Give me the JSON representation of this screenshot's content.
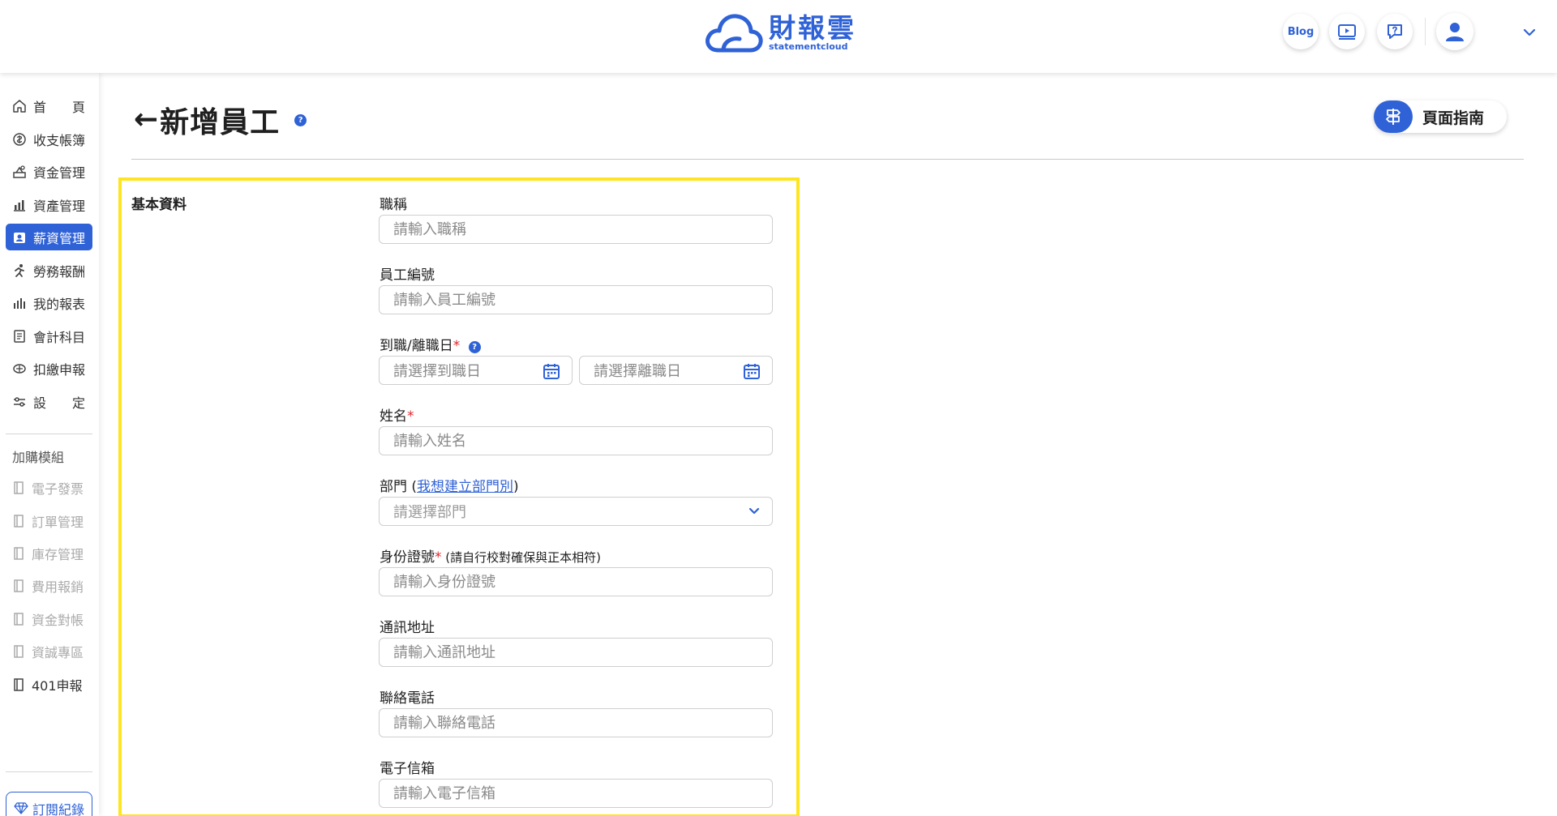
{
  "header": {
    "logo_title": "財報雲",
    "logo_sub": "statementcloud",
    "blog_label": "Blog",
    "colors": {
      "accent": "#2f62d6",
      "highlight": "#ffe51f",
      "required": "#e0252b"
    }
  },
  "sidebar": {
    "items": [
      {
        "chars": [
          "首",
          "頁"
        ],
        "icon": "home-icon"
      },
      {
        "label": "收支帳簿",
        "icon": "money-circle-icon"
      },
      {
        "label": "資金管理",
        "icon": "fund-icon"
      },
      {
        "label": "資產管理",
        "icon": "asset-chart-icon"
      },
      {
        "label": "薪資管理",
        "icon": "payroll-icon",
        "active": true
      },
      {
        "label": "勞務報酬",
        "icon": "runner-icon"
      },
      {
        "label": "我的報表",
        "icon": "bar-chart-icon"
      },
      {
        "label": "會計科目",
        "icon": "ledger-icon"
      },
      {
        "label": "扣繳申報",
        "icon": "tax-icon"
      },
      {
        "chars": [
          "設",
          "定"
        ],
        "icon": "settings-sliders-icon"
      }
    ],
    "addon_heading": "加購模組",
    "addons": [
      {
        "label": "電子發票",
        "disabled": true
      },
      {
        "label": "訂單管理",
        "disabled": true
      },
      {
        "label": "庫存管理",
        "disabled": true
      },
      {
        "label": "費用報銷",
        "disabled": true
      },
      {
        "label": "資金對帳",
        "disabled": true
      },
      {
        "label": "資誠專區",
        "disabled": true
      },
      {
        "label": "401申報",
        "disabled": false
      }
    ],
    "subscription_label": "訂閱紀錄"
  },
  "main": {
    "back_arrow": "←",
    "title": "新增員工",
    "help_glyph": "?",
    "guide_label": "頁面指南",
    "section_label": "基本資料",
    "fields": {
      "job_title": {
        "label": "職稱",
        "placeholder": "請輸入職稱"
      },
      "employee_no": {
        "label": "員工編號",
        "placeholder": "請輸入員工編號"
      },
      "dates": {
        "label": "到職/離職日",
        "required": "*",
        "start_placeholder": "請選擇到職日",
        "end_placeholder": "請選擇離職日"
      },
      "name": {
        "label": "姓名",
        "required": "*",
        "placeholder": "請輸入姓名"
      },
      "department": {
        "label": "部門",
        "open_paren": " (",
        "link": "我想建立部門別",
        "close_paren": ")",
        "placeholder": "請選擇部門"
      },
      "id_no": {
        "label": "身份證號",
        "required": "*",
        "hint": " (請自行校對確保與正本相符)",
        "placeholder": "請輸入身份證號"
      },
      "address": {
        "label": "通訊地址",
        "placeholder": "請輸入通訊地址"
      },
      "phone": {
        "label": "聯絡電話",
        "placeholder": "請輸入聯絡電話"
      },
      "email": {
        "label": "電子信箱",
        "placeholder": "請輸入電子信箱"
      }
    }
  }
}
